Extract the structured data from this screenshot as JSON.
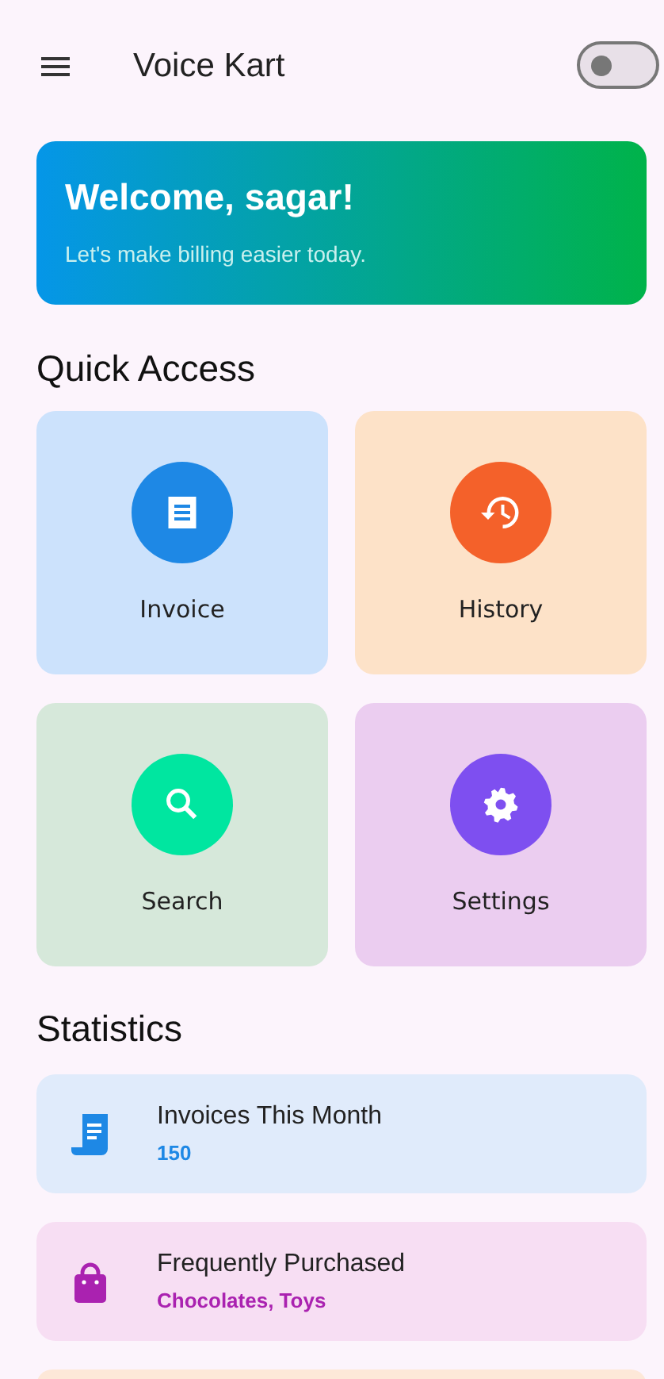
{
  "app_bar": {
    "title": "Voice Kart",
    "toggle": {
      "on": false
    }
  },
  "welcome": {
    "title": "Welcome, sagar!",
    "subtitle": "Let's make billing easier today."
  },
  "quick_access": {
    "heading": "Quick Access",
    "tiles": [
      {
        "label": "Invoice",
        "kind": "invoice",
        "color": "#cce2fc"
      },
      {
        "label": "History",
        "kind": "history",
        "color": "#fde2c8"
      },
      {
        "label": "Search",
        "kind": "search",
        "color": "#d6e8da"
      },
      {
        "label": "Settings",
        "kind": "settings",
        "color": "#ebcdf0"
      }
    ]
  },
  "statistics": {
    "heading": "Statistics",
    "items": [
      {
        "title": "Invoices This Month",
        "value": "150",
        "kind": "receipt",
        "color": "#e0ebfb"
      },
      {
        "title": "Frequently Purchased",
        "value": "Chocolates, Toys",
        "kind": "bag",
        "color": "#f7def3"
      },
      {
        "kind": "partial",
        "color": "#fde8d8"
      }
    ]
  }
}
